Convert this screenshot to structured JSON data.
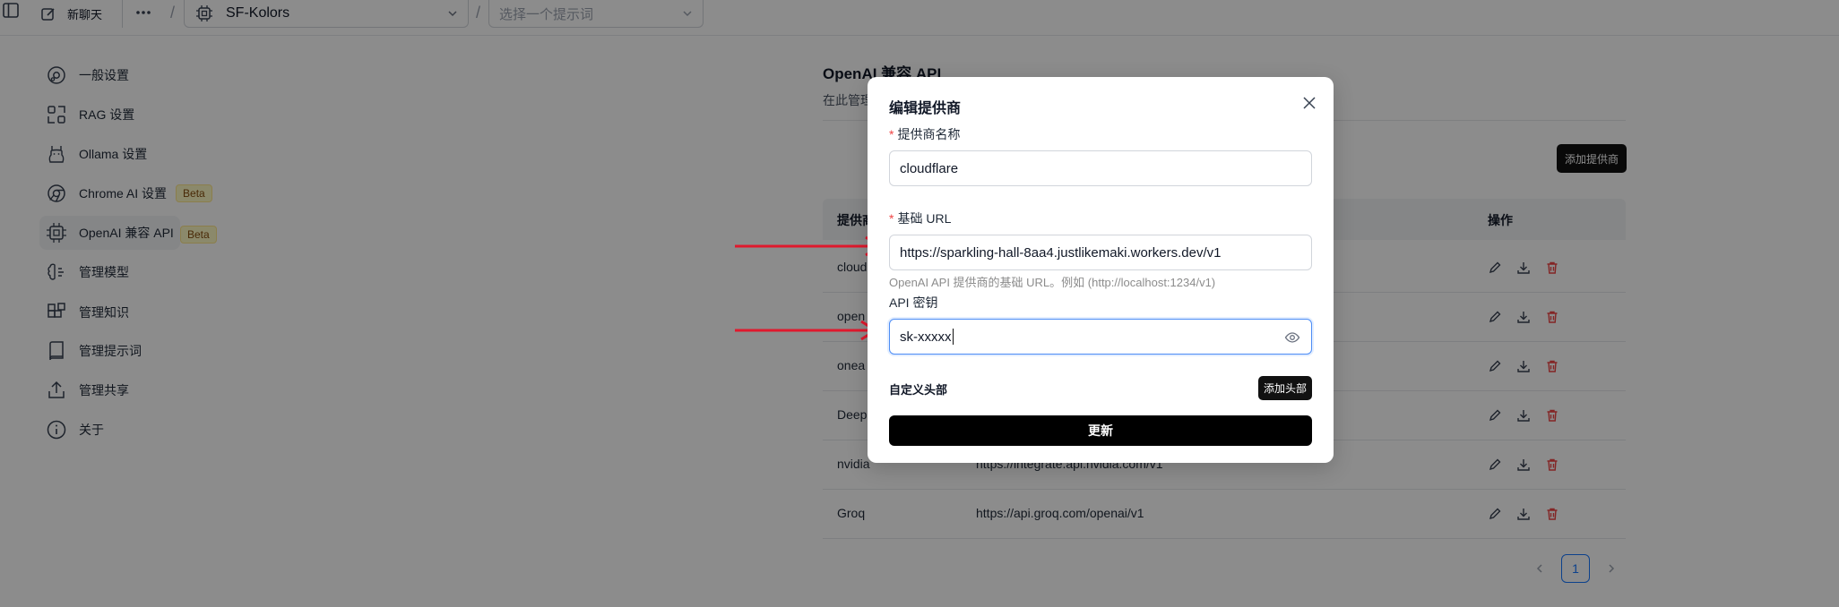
{
  "topbar": {
    "new_chat_label": "新聊天",
    "model_selected": "SF-Kolors",
    "prompt_placeholder": "选择一个提示词",
    "separator": "/"
  },
  "sidebar": {
    "items": [
      {
        "label": "一般设置",
        "icon": "settings-circle-icon"
      },
      {
        "label": "RAG 设置",
        "icon": "rag-grid-icon"
      },
      {
        "label": "Ollama 设置",
        "icon": "ollama-llama-icon"
      },
      {
        "label": "Chrome AI 设置",
        "icon": "chrome-icon",
        "badge": "Beta"
      },
      {
        "label": "OpenAI 兼容 API",
        "icon": "cpu-chip-icon",
        "badge": "Beta",
        "active": true
      },
      {
        "label": "管理模型",
        "icon": "brain-icon"
      },
      {
        "label": "管理知识",
        "icon": "blocks-icon"
      },
      {
        "label": "管理提示词",
        "icon": "book-icon"
      },
      {
        "label": "管理共享",
        "icon": "share-icon"
      },
      {
        "label": "关于",
        "icon": "info-circle-icon"
      }
    ]
  },
  "content": {
    "title": "OpenAI 兼容 API",
    "description": "在此管理",
    "add_provider_label": "添加提供商",
    "table": {
      "headers": {
        "provider": "提供商",
        "actions": "操作"
      },
      "rows": [
        {
          "name": "cloud",
          "url": ""
        },
        {
          "name": "open",
          "url": ""
        },
        {
          "name": "onea",
          "url": ""
        },
        {
          "name": "Deep",
          "url": ""
        },
        {
          "name": "nvidia",
          "url": "https://integrate.api.nvidia.com/v1"
        },
        {
          "name": "Groq",
          "url": "https://api.groq.com/openai/v1"
        }
      ]
    },
    "pagination": {
      "current_page": "1"
    }
  },
  "modal": {
    "title": "编辑提供商",
    "name_label": "提供商名称",
    "name_value": "cloudflare",
    "url_label": "基础 URL",
    "url_value": "https://sparkling-hall-8aa4.justlikemaki.workers.dev/v1",
    "url_hint": "OpenAI API 提供商的基础 URL。例如 (http://localhost:1234/v1)",
    "key_label": "API 密钥",
    "key_value": "sk-xxxxx",
    "required_mark": "*",
    "custom_headers_label": "自定义头部",
    "add_header_label": "添加头部",
    "update_label": "更新"
  },
  "colors": {
    "accent": "#1677ff",
    "danger": "#ef4444",
    "annotation_arrow": "#e0192d",
    "beta_bg": "#fef9c3"
  }
}
